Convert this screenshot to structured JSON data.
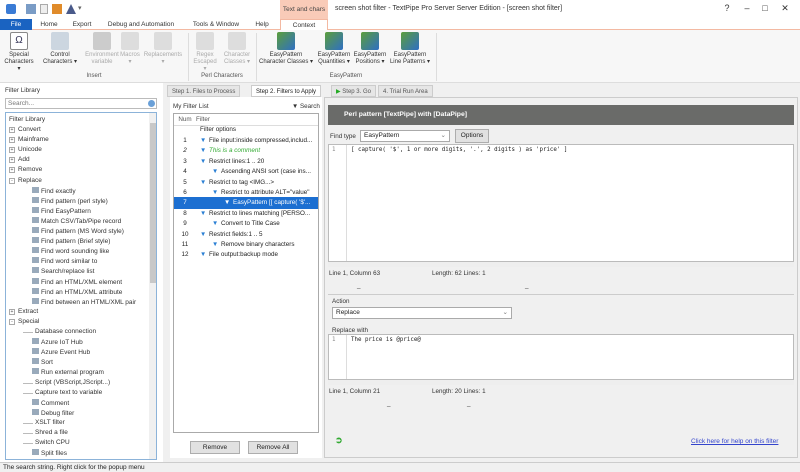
{
  "window": {
    "title": "screen shot filter - TextPipe Pro Server Server Edition - [screen shot filter]",
    "context_label": "Text and chars"
  },
  "ribbon_tabs": [
    "File",
    "Home",
    "Export",
    "Debug and Automation",
    "Tools & Window",
    "Help",
    "Context"
  ],
  "ribbon": {
    "insert": {
      "label": "Insert",
      "buttons": [
        "Special Characters ▾",
        "Control Characters ▾",
        "Environment variable",
        "Macros ▾",
        "Replacements ▾"
      ]
    },
    "perl": {
      "label": "Perl Characters",
      "buttons": [
        "Regex Escaped ▾",
        "Character Classes ▾"
      ]
    },
    "easypattern": {
      "label": "EasyPattern",
      "buttons": [
        "EasyPattern Character Classes ▾",
        "EasyPattern Quantities ▾",
        "EasyPattern Positions ▾",
        "EasyPattern Line Patterns ▾"
      ]
    }
  },
  "library": {
    "title": "Filter Library",
    "search_placeholder": "Search...",
    "root": "Filter Library",
    "items": [
      {
        "label": "Convert",
        "level": 0,
        "exp": "+"
      },
      {
        "label": "Mainframe",
        "level": 0,
        "exp": "+"
      },
      {
        "label": "Unicode",
        "level": 0,
        "exp": "+"
      },
      {
        "label": "Add",
        "level": 0,
        "exp": "+"
      },
      {
        "label": "Remove",
        "level": 0,
        "exp": "+"
      },
      {
        "label": "Replace",
        "level": 0,
        "exp": "-"
      },
      {
        "label": "Find exactly",
        "level": 1
      },
      {
        "label": "Find pattern (perl style)",
        "level": 1
      },
      {
        "label": "Find EasyPattern",
        "level": 1
      },
      {
        "label": "Match CSV/Tab/Pipe record",
        "level": 1
      },
      {
        "label": "Find pattern (MS Word style)",
        "level": 1
      },
      {
        "label": "Find pattern (Brief style)",
        "level": 1
      },
      {
        "label": "Find word sounding like",
        "level": 1
      },
      {
        "label": "Find word similar to",
        "level": 1
      },
      {
        "label": "Search/replace list",
        "level": 1
      },
      {
        "label": "Find an HTML/XML element",
        "level": 1
      },
      {
        "label": "Find an HTML/XML attribute",
        "level": 1
      },
      {
        "label": "Find between an HTML/XML pair",
        "level": 1
      },
      {
        "label": "Extract",
        "level": 0,
        "exp": "+"
      },
      {
        "label": "Special",
        "level": 0,
        "exp": "-"
      },
      {
        "label": "Database connection",
        "level": 2
      },
      {
        "label": "Azure IoT Hub",
        "level": 1
      },
      {
        "label": "Azure Event Hub",
        "level": 1
      },
      {
        "label": "Sort",
        "level": 1
      },
      {
        "label": "Run external program",
        "level": 1
      },
      {
        "label": "Script (VBScript,JScript...)",
        "level": 2
      },
      {
        "label": "Capture text to variable",
        "level": 2
      },
      {
        "label": "Comment",
        "level": 1
      },
      {
        "label": "Debug filter",
        "level": 1
      },
      {
        "label": "XSLT filter",
        "level": 2
      },
      {
        "label": "Shred a file",
        "level": 2
      },
      {
        "label": "Switch CPU",
        "level": 2
      },
      {
        "label": "Split files",
        "level": 1
      }
    ]
  },
  "steps": [
    "Step 1. Files to Process",
    "Step 2. Filters to Apply",
    "Step 3. Go",
    "4. Trial Run Area"
  ],
  "filter_list": {
    "title": "My Filter List",
    "search": "▼ Search",
    "col_num": "Num",
    "col_filter": "Filter",
    "root": "Filter options",
    "rows": [
      {
        "num": "1",
        "label": "File input:inside compressed,includ...",
        "indent": 1
      },
      {
        "num": "2",
        "label": "This is a comment",
        "indent": 1,
        "comment": true
      },
      {
        "num": "3",
        "label": "Restrict lines:1 .. 20",
        "indent": 1
      },
      {
        "num": "4",
        "label": "Ascending ANSI sort (case ins...",
        "indent": 2
      },
      {
        "num": "5",
        "label": "Restrict to tag <IMG...>",
        "indent": 1
      },
      {
        "num": "6",
        "label": "Restrict to attribute ALT=\"value\"",
        "indent": 2
      },
      {
        "num": "7",
        "label": "EasyPattern [[ capture( '$'...",
        "indent": 3,
        "selected": true
      },
      {
        "num": "8",
        "label": "Restrict to lines matching [PERSO...",
        "indent": 1
      },
      {
        "num": "9",
        "label": "Convert to Title Case",
        "indent": 2
      },
      {
        "num": "10",
        "label": "Restrict fields:1 .. 5",
        "indent": 1
      },
      {
        "num": "11",
        "label": "Remove binary characters",
        "indent": 2
      },
      {
        "num": "12",
        "label": "File output:backup mode",
        "indent": 1
      }
    ],
    "remove": "Remove",
    "remove_all": "Remove All"
  },
  "editor": {
    "header": "Perl pattern [TextPipe] with [DataPipe]",
    "find_type_label": "Find type",
    "find_type": "EasyPattern",
    "options": "Options",
    "find_line": "1",
    "find_text": "[ capture( '$', 1 or more digits, '.', 2 digits ) as 'price' ]",
    "find_status_pos": "Line 1, Column 63",
    "find_status_len": "Length: 62  Lines: 1",
    "action_label": "Action",
    "action": "Replace",
    "replace_label": "Replace with",
    "replace_line": "1",
    "replace_text": "The price is @price@",
    "replace_status_pos": "Line 1, Column 21",
    "replace_status_len": "Length: 20  Lines: 1",
    "help_link": "Click here for help on this filter",
    "dash": "_"
  },
  "status": "The search string. Right click for the popup menu"
}
